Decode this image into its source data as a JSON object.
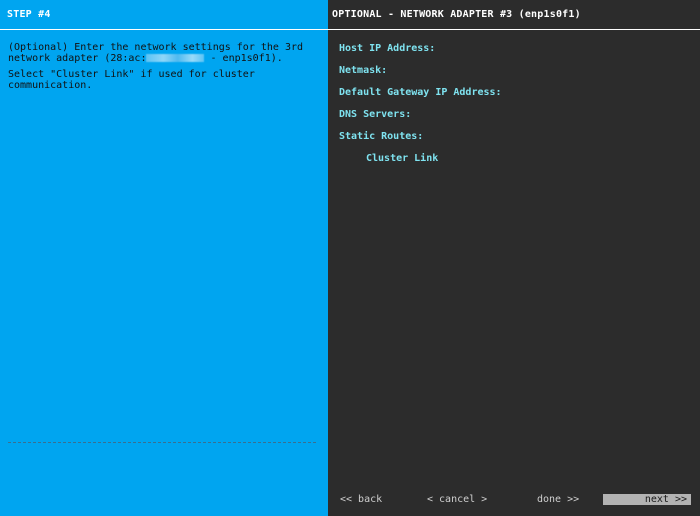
{
  "left": {
    "step_title": "STEP #4",
    "description_line1": "(Optional) Enter the network settings for the 3rd",
    "description_line2_prefix": "network adapter (28:ac:",
    "description_line2_suffix": " - enp1s0f1).",
    "description_line3": "Select \"Cluster Link\" if used for cluster",
    "description_line4": "communication.",
    "background_color": "#00a5f0"
  },
  "right": {
    "panel_title": "OPTIONAL - NETWORK ADAPTER #3 (enp1s0f1)",
    "fields": {
      "host_ip": "Host IP Address:",
      "netmask": "Netmask:",
      "gateway": "Default Gateway IP Address:",
      "dns": "DNS Servers:",
      "static_routes": "Static Routes:"
    },
    "cluster_link_label": "Cluster Link",
    "label_color": "#7fe3f0",
    "background_color": "#2c2c2c"
  },
  "nav": {
    "back": "<< back",
    "cancel": "< cancel >",
    "done": "done >>",
    "next": "next >>",
    "active": "next"
  }
}
